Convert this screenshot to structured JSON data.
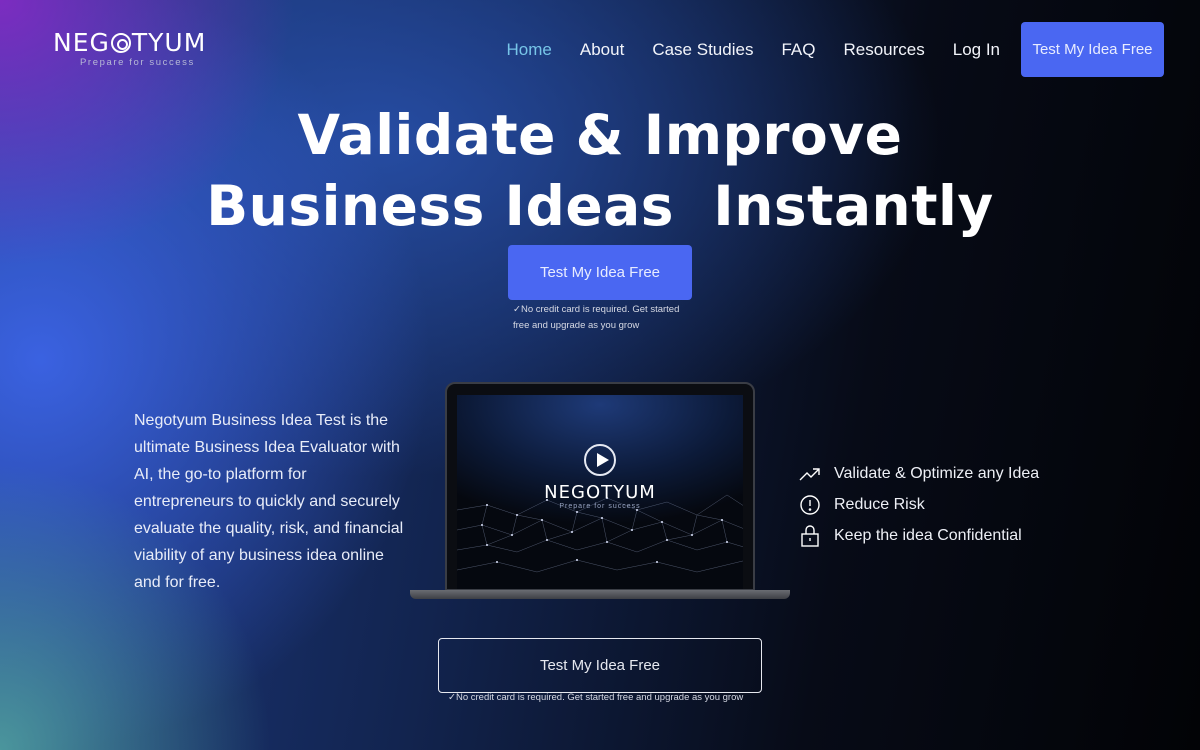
{
  "brand": {
    "name": "NEGOTYUM",
    "name_parts": [
      "NEG",
      "TYUM"
    ],
    "tagline": "Prepare for success"
  },
  "nav": {
    "items": [
      {
        "label": "Home",
        "active": true
      },
      {
        "label": "About",
        "active": false
      },
      {
        "label": "Case Studies",
        "active": false
      },
      {
        "label": "FAQ",
        "active": false
      },
      {
        "label": "Resources",
        "active": false
      },
      {
        "label": "Log In",
        "active": false
      }
    ],
    "cta_label": "Test My Idea Free"
  },
  "hero": {
    "title_line1": "Validate & Improve",
    "title_line2": "Business Ideas  Instantly",
    "cta_label": "Test My Idea Free",
    "note": "✓No credit card is required. Get started free and upgrade as you grow"
  },
  "description": "Negotyum Business Idea Test is the ultimate Business Idea Evaluator with AI,  the go-to platform for entrepreneurs to quickly and securely evaluate the quality, risk, and financial viability of any business idea online and for free.",
  "video": {
    "logo": "NEGOTYUM",
    "tagline": "Prepare for success",
    "play_icon": "play-icon"
  },
  "features": [
    {
      "icon": "trending-up-icon",
      "label": "Validate & Optimize any Idea"
    },
    {
      "icon": "alert-circle-icon",
      "label": "Reduce Risk"
    },
    {
      "icon": "lock-icon",
      "label": "Keep the idea Confidential"
    }
  ],
  "bottom_cta": {
    "label": "Test My Idea Free",
    "note": "✓No credit card is required. Get started free and upgrade as you grow"
  },
  "colors": {
    "accent": "#4a67f2",
    "active_nav": "#77c5e8"
  }
}
